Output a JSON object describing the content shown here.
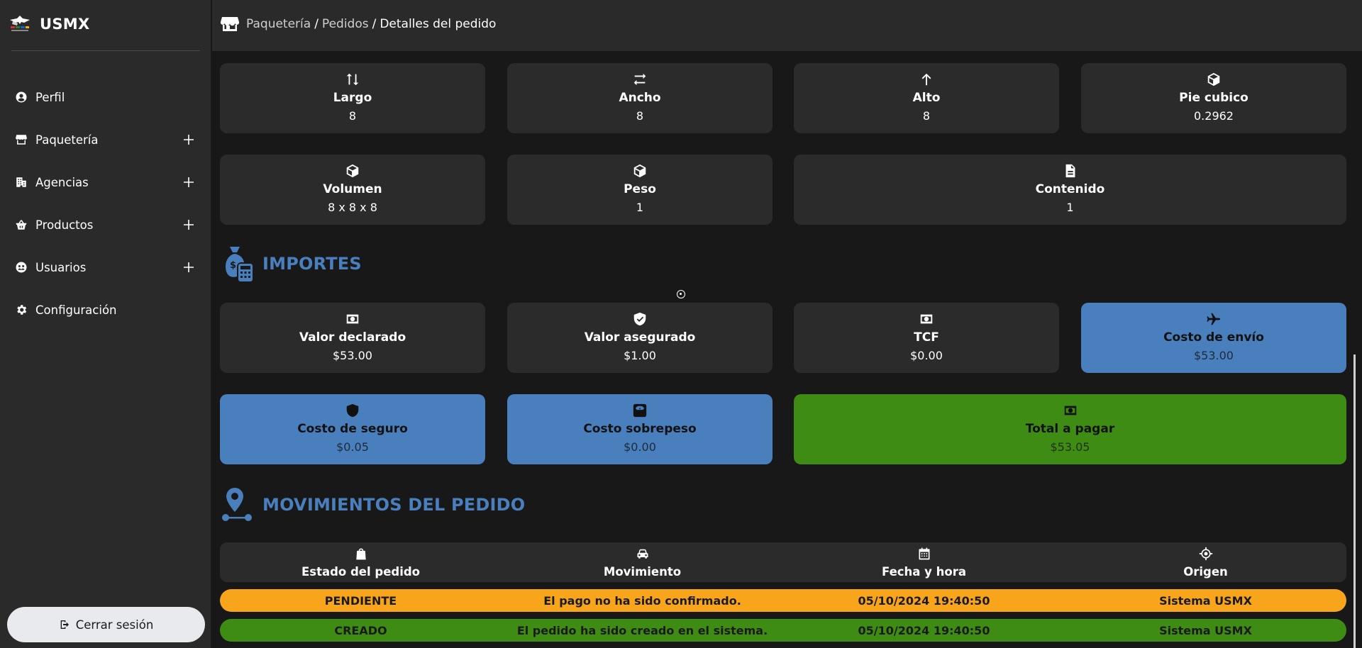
{
  "brand": {
    "name": "USMX"
  },
  "sidebar": {
    "items": [
      {
        "label": "Perfil",
        "icon": "user-circle-icon",
        "expandable": false
      },
      {
        "label": "Paquetería",
        "icon": "store-icon",
        "expandable": true
      },
      {
        "label": "Agencias",
        "icon": "building-icon",
        "expandable": true
      },
      {
        "label": "Productos",
        "icon": "basket-icon",
        "expandable": true
      },
      {
        "label": "Usuarios",
        "icon": "users-icon",
        "expandable": true
      },
      {
        "label": "Configuración",
        "icon": "gear-icon",
        "expandable": false
      }
    ],
    "logout_label": "Cerrar sesión"
  },
  "breadcrumb": {
    "items": [
      "Paquetería",
      "Pedidos"
    ],
    "current": "Detalles del pedido",
    "separator": "/"
  },
  "dimensions": [
    {
      "label": "Largo",
      "value": "8",
      "icon": "arrows-up-down-icon"
    },
    {
      "label": "Ancho",
      "value": "8",
      "icon": "arrows-left-right-icon"
    },
    {
      "label": "Alto",
      "value": "8",
      "icon": "arrow-up-icon"
    },
    {
      "label": "Pie cubico",
      "value": "0.2962",
      "icon": "cube-icon"
    },
    {
      "label": "Volumen",
      "value": "8 x 8 x 8",
      "icon": "cube-icon"
    },
    {
      "label": "Peso",
      "value": "1",
      "icon": "cube-icon"
    },
    {
      "label": "Contenido",
      "value": "1",
      "icon": "document-icon"
    }
  ],
  "importes": {
    "title": "IMPORTES",
    "cards": [
      {
        "label": "Valor declarado",
        "value": "$53.00",
        "icon": "money-icon"
      },
      {
        "label": "Valor asegurado",
        "value": "$1.00",
        "icon": "shield-check-icon"
      },
      {
        "label": "TCF",
        "value": "$0.00",
        "icon": "money-icon"
      },
      {
        "label": "Costo de envío",
        "value": "$53.00",
        "icon": "plane-icon"
      },
      {
        "label": "Costo de seguro",
        "value": "$0.05",
        "icon": "shield-icon"
      },
      {
        "label": "Costo sobrepeso",
        "value": "$0.00",
        "icon": "weight-icon"
      },
      {
        "label": "Total a pagar",
        "value": "$53.05",
        "icon": "money-icon"
      }
    ]
  },
  "movimientos": {
    "title": "MOVIMIENTOS DEL PEDIDO",
    "headers": [
      {
        "label": "Estado del pedido",
        "icon": "shopping-bag-icon"
      },
      {
        "label": "Movimiento",
        "icon": "car-icon"
      },
      {
        "label": "Fecha y hora",
        "icon": "calendar-icon"
      },
      {
        "label": "Origen",
        "icon": "crosshair-icon"
      }
    ],
    "rows": [
      {
        "estado": "PENDIENTE",
        "movimiento": "El pago no ha sido confirmado.",
        "fecha": "05/10/2024 19:40:50",
        "origen": "Sistema USMX"
      },
      {
        "estado": "CREADO",
        "movimiento": "El pedido ha sido creado en el sistema.",
        "fecha": "05/10/2024 19:40:50",
        "origen": "Sistema USMX"
      }
    ]
  },
  "colors": {
    "accent_blue": "#4a7fbe",
    "total_green": "#3f8c14",
    "pending_orange": "#f8a51b",
    "card_bg": "#2b2b2b",
    "page_bg": "#181818"
  }
}
